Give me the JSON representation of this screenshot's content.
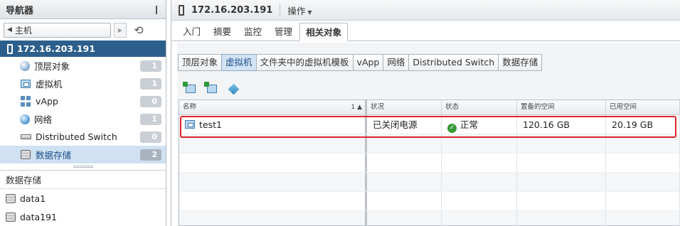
{
  "navigator": {
    "title": "导航器",
    "home_label": "主机",
    "host": "172.16.203.191",
    "items": [
      {
        "label": "顶层对象",
        "count": "1",
        "icon": "globe-icon"
      },
      {
        "label": "虚拟机",
        "count": "1",
        "icon": "vm-icon"
      },
      {
        "label": "vApp",
        "count": "0",
        "icon": "vapp-icon"
      },
      {
        "label": "网络",
        "count": "1",
        "icon": "network-icon"
      },
      {
        "label": "Distributed Switch",
        "count": "0",
        "icon": "switch-icon"
      },
      {
        "label": "数据存储",
        "count": "2",
        "icon": "datastore-icon"
      }
    ],
    "section_title": "数据存储",
    "datastores": [
      "data1",
      "data191"
    ]
  },
  "main": {
    "title": "172.16.203.191",
    "actions_label": "操作",
    "tabs": [
      "入门",
      "摘要",
      "监控",
      "管理",
      "相关对象"
    ],
    "subtabs": [
      "顶层对象",
      "虚拟机",
      "文件夹中的虚拟机模板",
      "vApp",
      "网络",
      "Distributed Switch",
      "数据存储"
    ],
    "table": {
      "columns": [
        "名称",
        "状况",
        "状态",
        "置备的空间",
        "已用空间"
      ],
      "sort_indicator": "1 ▲",
      "rows": [
        {
          "name": "test1",
          "power": "已关闭电源",
          "status": "正常",
          "provisioned": "120.16  GB",
          "used": "20.19  GB"
        }
      ]
    }
  },
  "colors": {
    "selection": "#2d5f8c",
    "highlight": "#e0232b",
    "status_ok": "#3a9a3a"
  }
}
